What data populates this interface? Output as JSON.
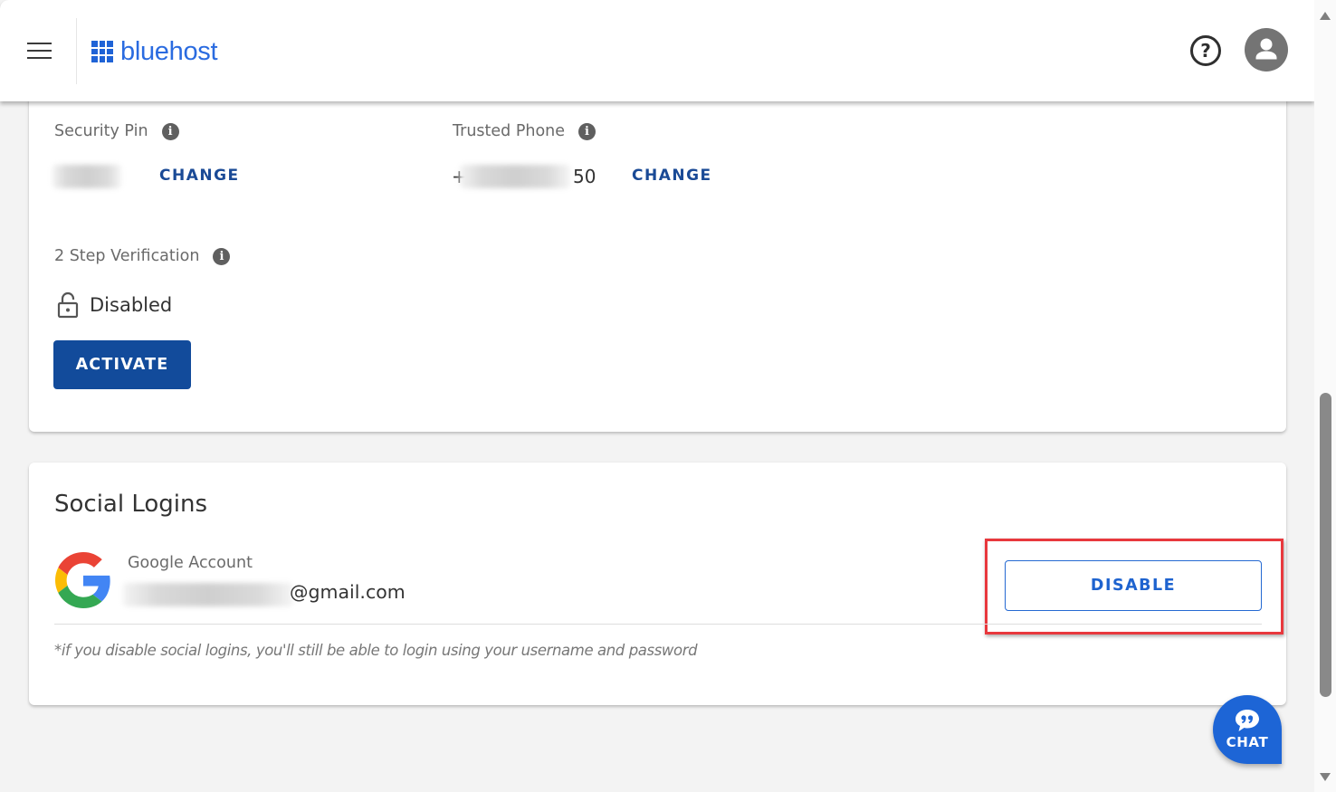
{
  "header": {
    "logo_text": "bluehost",
    "menu_icon": "hamburger-menu-icon",
    "help_icon": "help-circle-icon",
    "help_glyph": "?",
    "avatar_icon": "user-avatar-icon"
  },
  "security": {
    "security_pin": {
      "label": "Security Pin",
      "value_hidden": true,
      "change_label": "CHANGE"
    },
    "trusted_phone": {
      "label": "Trusted Phone",
      "value_prefix": "+",
      "value_suffix": "50",
      "change_label": "CHANGE"
    },
    "two_step": {
      "label": "2 Step Verification",
      "status": "Disabled",
      "status_icon": "unlocked-padlock-icon",
      "activate_label": "ACTIVATE"
    },
    "info_glyph": "i"
  },
  "social_logins": {
    "title": "Social Logins",
    "accounts": [
      {
        "provider": "Google Account",
        "provider_icon": "google-g-icon",
        "email_domain": "@gmail.com",
        "email_local_hidden": true,
        "action_label": "DISABLE"
      }
    ],
    "disclaimer": "*if you disable social logins, you'll still be able to login using your username and password"
  },
  "chat": {
    "label": "CHAT",
    "icon": "quote-bubble-icon"
  },
  "colors": {
    "brand_blue": "#1f63d6",
    "primary_button": "#124b9b",
    "link_blue": "#1a4a96",
    "highlight_red": "#e8383d",
    "page_bg": "#f3f3f3"
  }
}
